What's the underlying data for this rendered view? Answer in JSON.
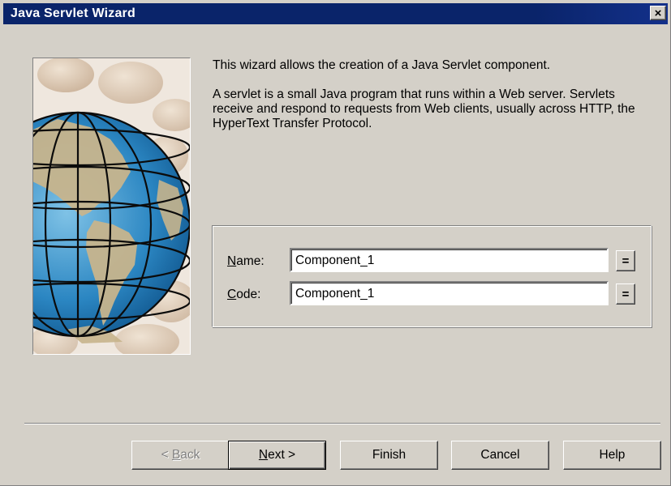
{
  "window": {
    "title": "Java Servlet Wizard",
    "close_label": "×"
  },
  "intro": {
    "line1": "This wizard allows the creation of a Java Servlet component.",
    "line2": "A servlet is a small Java program that runs within a Web server. Servlets receive and respond to requests from Web clients, usually across HTTP, the HyperText Transfer Protocol."
  },
  "form": {
    "name": {
      "label_mnemonic": "N",
      "label_rest": "ame:",
      "value": "Component_1",
      "eq_label": "="
    },
    "code": {
      "label_mnemonic": "C",
      "label_rest": "ode:",
      "value": "Component_1",
      "eq_label": "="
    }
  },
  "buttons": {
    "back_prefix": "< ",
    "back_mnemonic": "B",
    "back_rest": "ack",
    "next_mnemonic": "N",
    "next_rest": "ext >",
    "finish": "Finish",
    "cancel": "Cancel",
    "help": "Help"
  },
  "colors": {
    "titlebar": "#0a246a",
    "dialog_face": "#d4d0c8"
  },
  "icons": {
    "illustration": "globe-illustration"
  }
}
